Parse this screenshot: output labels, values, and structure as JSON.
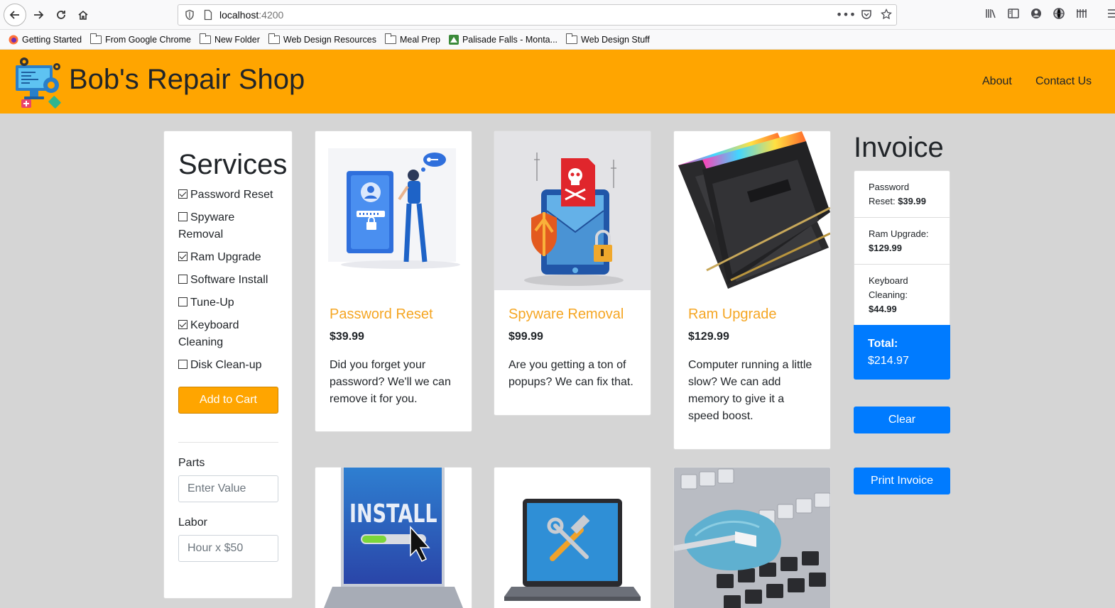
{
  "browser": {
    "url_host": "localhost",
    "url_port": ":4200",
    "bookmarks": [
      {
        "label": "Getting Started",
        "icon": "firefox-icon"
      },
      {
        "label": "From Google Chrome",
        "icon": "folder-icon"
      },
      {
        "label": "New Folder",
        "icon": "folder-icon"
      },
      {
        "label": "Web Design Resources",
        "icon": "folder-icon"
      },
      {
        "label": "Meal Prep",
        "icon": "folder-icon"
      },
      {
        "label": "Palisade Falls - Monta...",
        "icon": "alltrails-icon"
      },
      {
        "label": "Web Design Stuff",
        "icon": "folder-icon"
      }
    ]
  },
  "header": {
    "brand": "Bob's Repair Shop",
    "nav": [
      "About",
      "Contact Us"
    ],
    "color": "#ffa500"
  },
  "services": {
    "title": "Services",
    "items": [
      {
        "label": "Password Reset",
        "checked": true
      },
      {
        "label": "Spyware Removal",
        "checked": false
      },
      {
        "label": "Ram Upgrade",
        "checked": true
      },
      {
        "label": "Software Install",
        "checked": false
      },
      {
        "label": "Tune-Up",
        "checked": false
      },
      {
        "label": "Keyboard Cleaning",
        "checked": true
      },
      {
        "label": "Disk Clean-up",
        "checked": false
      }
    ],
    "add_to_cart": "Add to Cart",
    "parts_label": "Parts",
    "parts_placeholder": "Enter Value",
    "labor_label": "Labor",
    "labor_placeholder": "Hour x $50"
  },
  "cards": [
    {
      "title": "Password Reset",
      "price": "$39.99",
      "text": "Did you forget your password? We'll we can remove it for you.",
      "image": "password-reset-illustration"
    },
    {
      "title": "Spyware Removal",
      "price": "$99.99",
      "text": "Are you getting a ton of popups? We can fix that.",
      "image": "spyware-illustration"
    },
    {
      "title": "Ram Upgrade",
      "price": "$129.99",
      "text": "Computer running a little slow? We can add memory to give it a speed boost.",
      "image": "ram-photo"
    },
    {
      "title": "",
      "price": "",
      "text": "",
      "image": "install-illustration",
      "image_text": "INSTALL"
    },
    {
      "title": "",
      "price": "",
      "text": "",
      "image": "laptop-tools-illustration"
    },
    {
      "title": "",
      "price": "",
      "text": "",
      "image": "keyboard-cleaning-photo"
    }
  ],
  "invoice": {
    "title": "Invoice",
    "items": [
      {
        "name": "Password Reset:",
        "price": "$39.99"
      },
      {
        "name": "Ram Upgrade:",
        "price": "$129.99"
      },
      {
        "name": "Keyboard Cleaning:",
        "price": "$44.99"
      }
    ],
    "total_label": "Total:",
    "total_value": "$214.97",
    "clear": "Clear",
    "print": "Print Invoice",
    "accent": "#007bff"
  }
}
